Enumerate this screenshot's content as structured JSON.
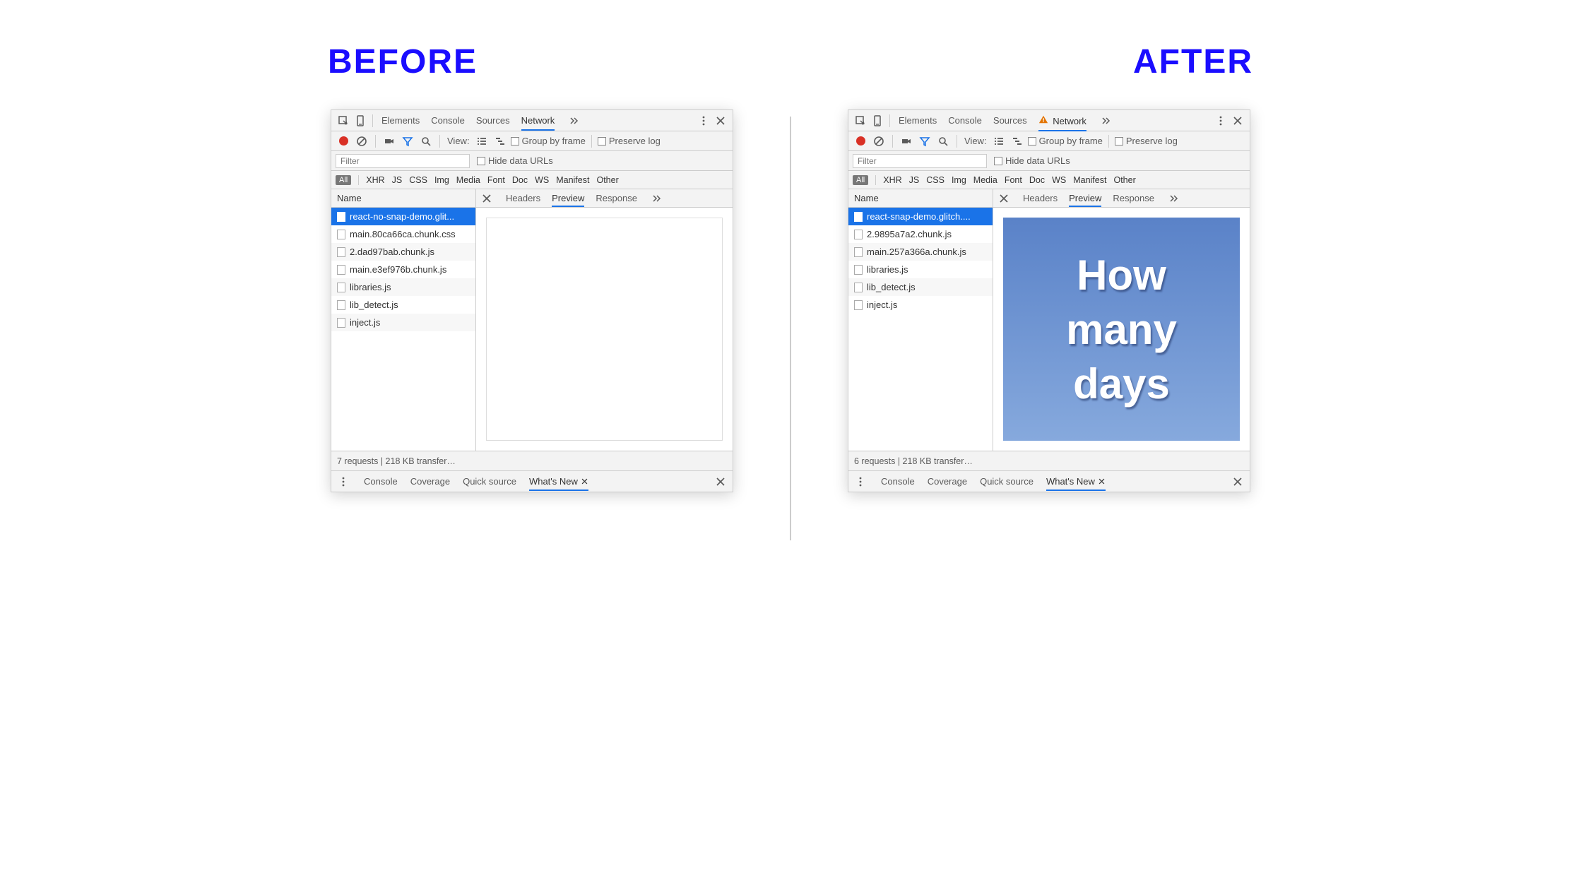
{
  "titles": {
    "before": "BEFORE",
    "after": "AFTER"
  },
  "top_tabs": {
    "elements": "Elements",
    "console": "Console",
    "sources": "Sources",
    "network": "Network"
  },
  "toolbar": {
    "view_label": "View:",
    "group_by_frame": "Group by frame",
    "preserve_log": "Preserve log"
  },
  "filter": {
    "placeholder": "Filter",
    "hide_data_urls": "Hide data URLs"
  },
  "types": {
    "all": "All",
    "xhr": "XHR",
    "js": "JS",
    "css": "CSS",
    "img": "Img",
    "media": "Media",
    "font": "Font",
    "doc": "Doc",
    "ws": "WS",
    "manifest": "Manifest",
    "other": "Other"
  },
  "list_header": "Name",
  "detail_tabs": {
    "headers": "Headers",
    "preview": "Preview",
    "response": "Response"
  },
  "drawer": {
    "console": "Console",
    "coverage": "Coverage",
    "quick_source": "Quick source",
    "whats_new": "What's New"
  },
  "before": {
    "requests": [
      "react-no-snap-demo.glit...",
      "main.80ca66ca.chunk.css",
      "2.dad97bab.chunk.js",
      "main.e3ef976b.chunk.js",
      "libraries.js",
      "lib_detect.js",
      "inject.js"
    ],
    "status": "7 requests | 218 KB transfer…",
    "has_warning": false,
    "preview_text": []
  },
  "after": {
    "requests": [
      "react-snap-demo.glitch....",
      "2.9895a7a2.chunk.js",
      "main.257a366a.chunk.js",
      "libraries.js",
      "lib_detect.js",
      "inject.js"
    ],
    "status": "6 requests | 218 KB transfer…",
    "has_warning": true,
    "preview_text": [
      "How",
      "many",
      "days"
    ]
  }
}
